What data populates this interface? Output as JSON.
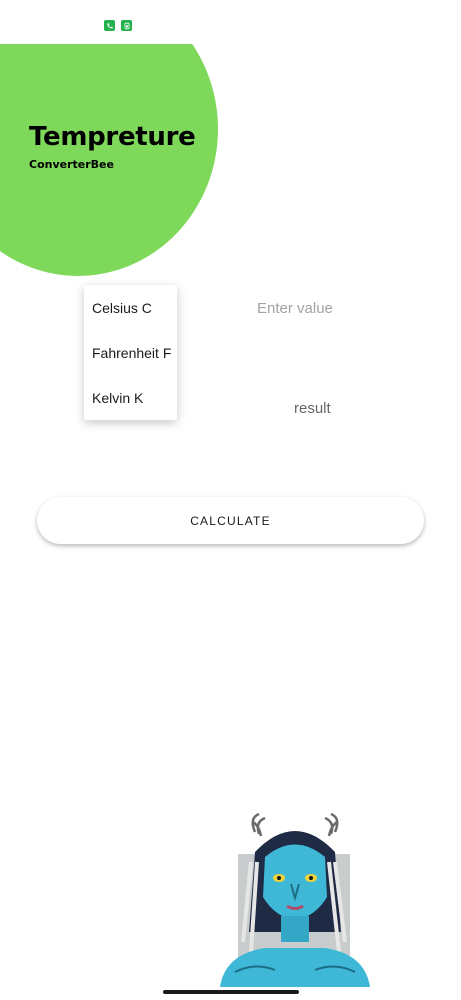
{
  "status_bar": {
    "icons": [
      "phone-icon",
      "sim-icon"
    ]
  },
  "header": {
    "title": "Tempreture",
    "subtitle": "ConverterBee"
  },
  "colors": {
    "accent_green": "#7ed85a",
    "status_green": "#22b14c",
    "avatar_skin": "#3fb7d6"
  },
  "units": {
    "options": [
      {
        "label": "Celsius C"
      },
      {
        "label": "Fahrenheit F"
      },
      {
        "label": "Kelvin K"
      }
    ]
  },
  "input": {
    "placeholder": "Enter value",
    "value": ""
  },
  "result": {
    "text": "result"
  },
  "calculate": {
    "label": "CALCULATE"
  }
}
